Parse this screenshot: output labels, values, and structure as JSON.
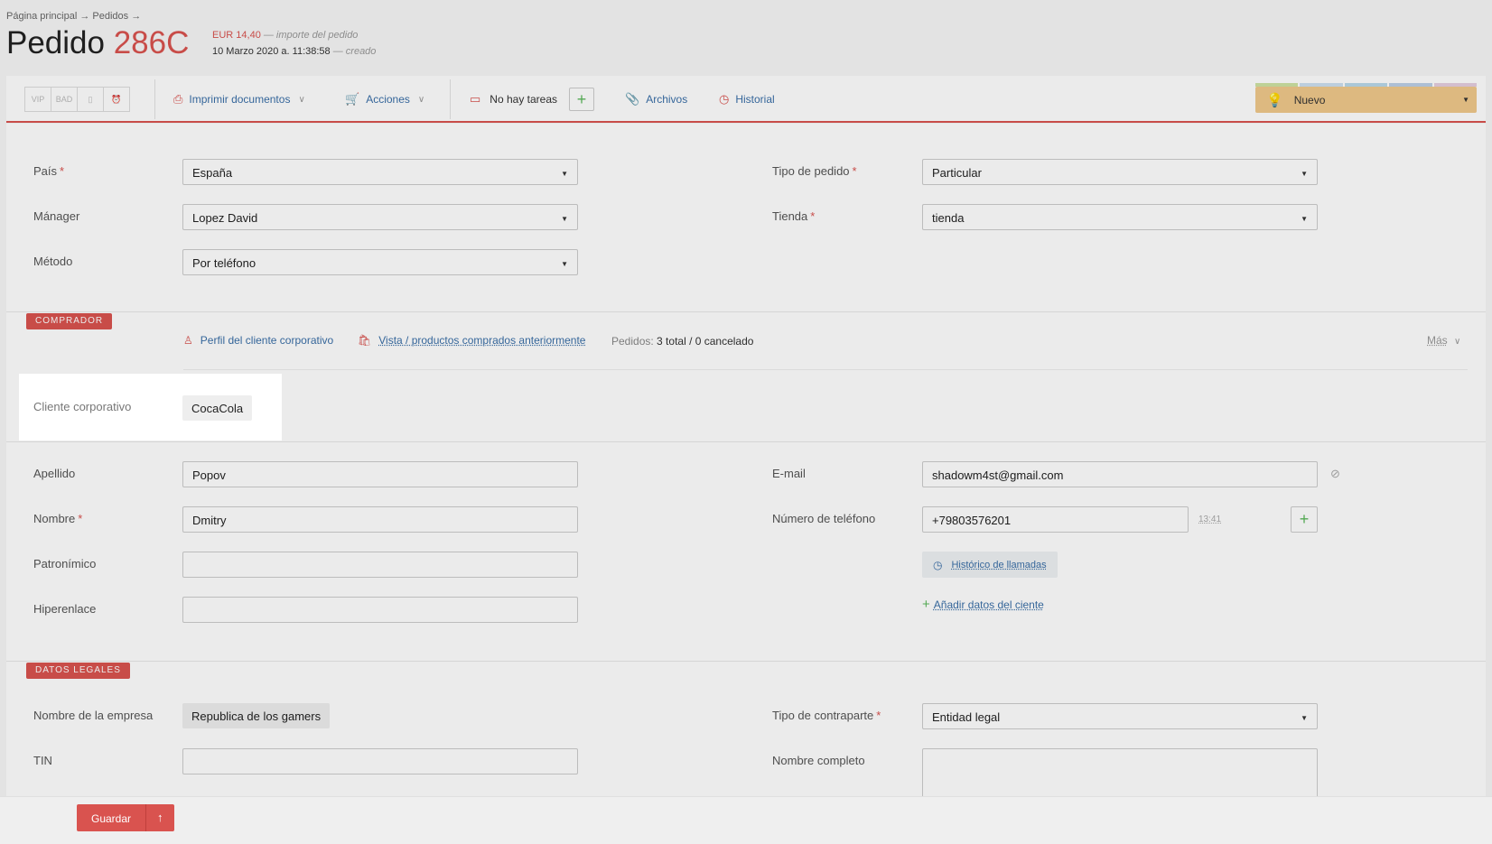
{
  "header": {
    "breadcrumb": "Página principal → Pedidos →",
    "title_prefix": "Pedido ",
    "order_number": "286C",
    "amount": "EUR 14,40",
    "amount_note": " — importe del pedido",
    "date": "10 Marzo 2020 a. 11:38:58",
    "date_note": " — creado"
  },
  "toolbar": {
    "tags": [
      "VIP",
      "BAD",
      "",
      ""
    ],
    "print_label": "Imprimir documentos",
    "actions_label": "Acciones",
    "tasks_label": "No hay tareas",
    "files_label": "Archivos",
    "history_label": "Historial",
    "status_label": "Nuevo",
    "status_strip_colors": [
      "#cfe3a3",
      "#cde0f0",
      "#b9d8ea",
      "#bcd0e6",
      "#e5cfe0"
    ]
  },
  "form": {
    "country_label": "País",
    "country_value": "España",
    "order_type_label": "Tipo de pedido",
    "order_type_value": "Particular",
    "manager_label": "Mánager",
    "manager_value": "Lopez David",
    "store_label": "Tienda",
    "store_value": "tienda",
    "method_label": "Método",
    "method_value": "Por teléfono"
  },
  "buyer": {
    "section_label": "COMPRADOR",
    "corp_profile_link": "Perfil del cliente corporativo",
    "view_products_link": "Vista / productos comprados anteriormente",
    "orders_label": "Pedidos:",
    "orders_value": "3 total / 0 cancelado",
    "more_label": "Más",
    "corp_client_label": "Cliente corporativo",
    "corp_client_value": "CocaCola",
    "surname_label": "Apellido",
    "surname_value": "Popov",
    "name_label": "Nombre",
    "name_value": "Dmitry",
    "patronymic_label": "Patronímico",
    "patronymic_value": "",
    "hyperlink_label": "Hiperenlace",
    "hyperlink_value": "",
    "email_label": "E-mail",
    "email_value": "shadowm4st@gmail.com",
    "phone_label": "Número de teléfono",
    "phone_value": "+79803576201",
    "phone_time": "13:41",
    "call_history_label": "Histórico de llamadas",
    "add_client_data_label": "Añadir datos del ciente"
  },
  "legal": {
    "section_label": "DATOS LEGALES",
    "company_name_label": "Nombre de la empresa",
    "company_name_value": "Republica de los gamers",
    "counterparty_type_label": "Tipo de contraparte",
    "counterparty_type_value": "Entidad legal",
    "tin_label": "TIN",
    "tin_value": "",
    "full_name_label": "Nombre completo",
    "full_name_value": ""
  },
  "footer": {
    "save_label": "Guardar",
    "up_label": "↑"
  }
}
